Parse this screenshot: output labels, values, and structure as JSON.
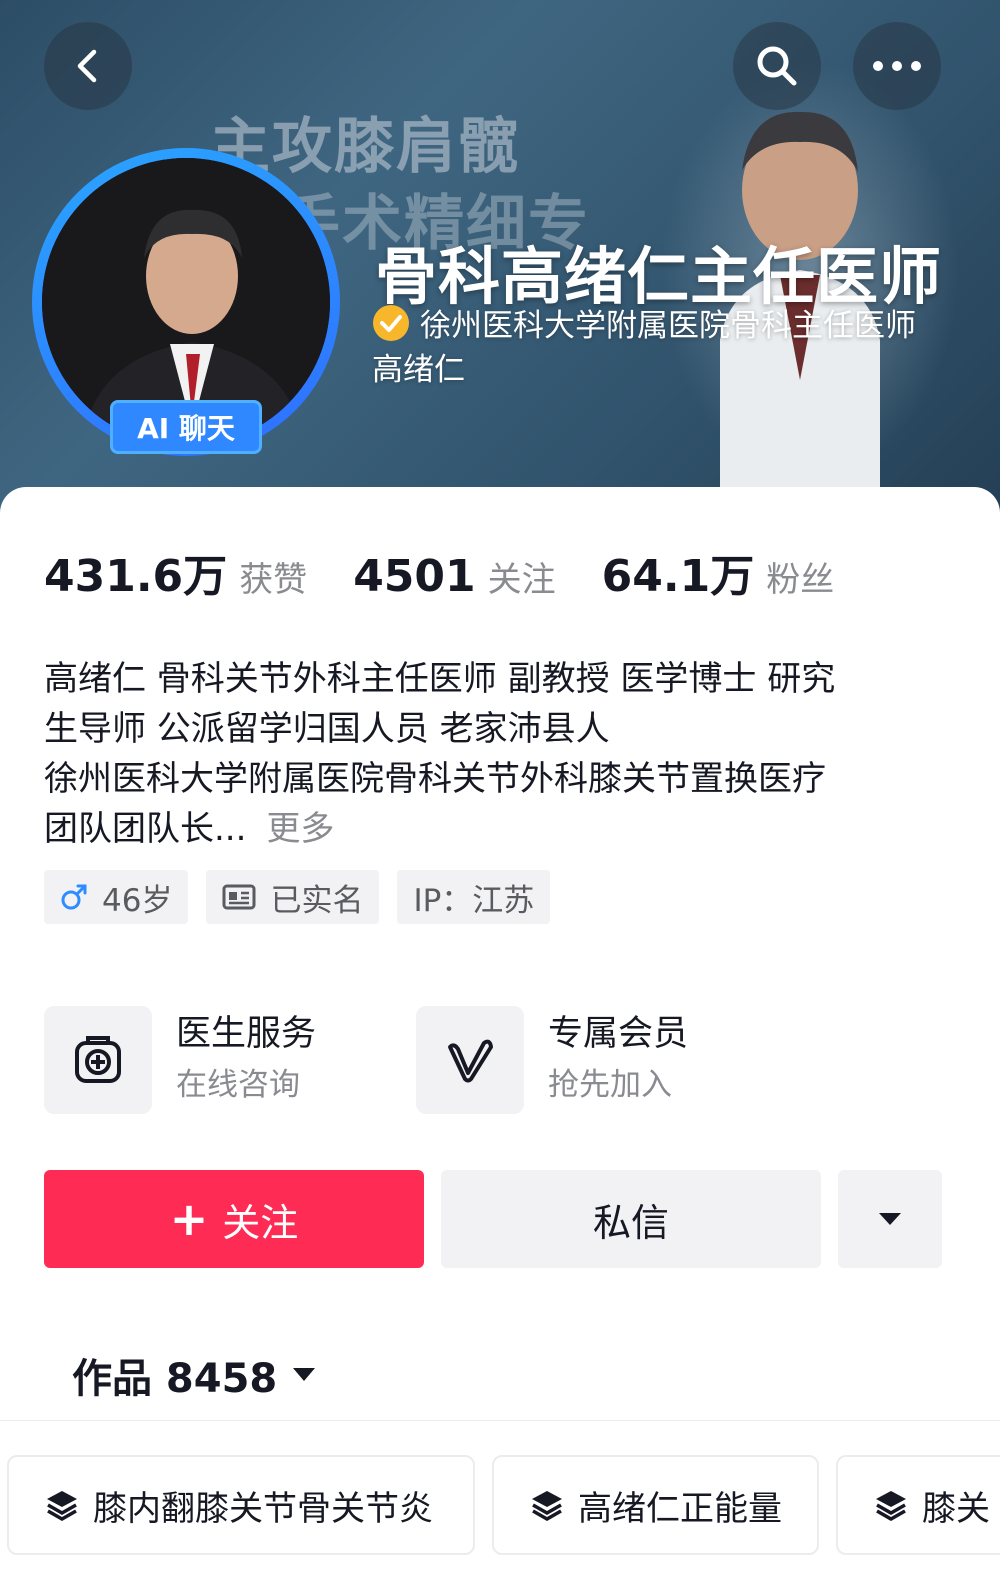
{
  "header": {
    "banner_text_line1": "主攻膝肩髋",
    "banner_text_line2": "手术精细专",
    "name": "骨科高绪仁主任医师",
    "verification": "徐州医科大学附属医院骨科主任医师 高绪仁",
    "ai_badge": "AI 聊天",
    "accent": "#2f88ff"
  },
  "stats": [
    {
      "value": "431.6万",
      "label": "获赞"
    },
    {
      "value": "4501",
      "label": "关注"
    },
    {
      "value": "64.1万",
      "label": "粉丝"
    }
  ],
  "bio": {
    "lines": [
      "高绪仁 骨科关节外科主任医师 副教授 医学博士 研究",
      "生导师 公派留学归国人员  老家沛县人",
      "徐州医科大学附属医院骨科关节外科膝关节置换医疗",
      "团队团队长..."
    ],
    "more": "更多"
  },
  "tags": {
    "age": "46岁",
    "verified": "已实名",
    "ip": "IP：江苏"
  },
  "services": [
    {
      "title": "医生服务",
      "subtitle": "在线咨询",
      "icon": "medical-kit-icon"
    },
    {
      "title": "专属会员",
      "subtitle": "抢先加入",
      "icon": "v-member-icon"
    }
  ],
  "actions": {
    "follow": "关注",
    "message": "私信",
    "follow_color": "#fe2c55"
  },
  "works": {
    "label": "作品 8458"
  },
  "collections": [
    {
      "title": "膝内翻膝关节骨关节炎"
    },
    {
      "title": "高绪仁正能量"
    },
    {
      "title": "膝关"
    }
  ]
}
